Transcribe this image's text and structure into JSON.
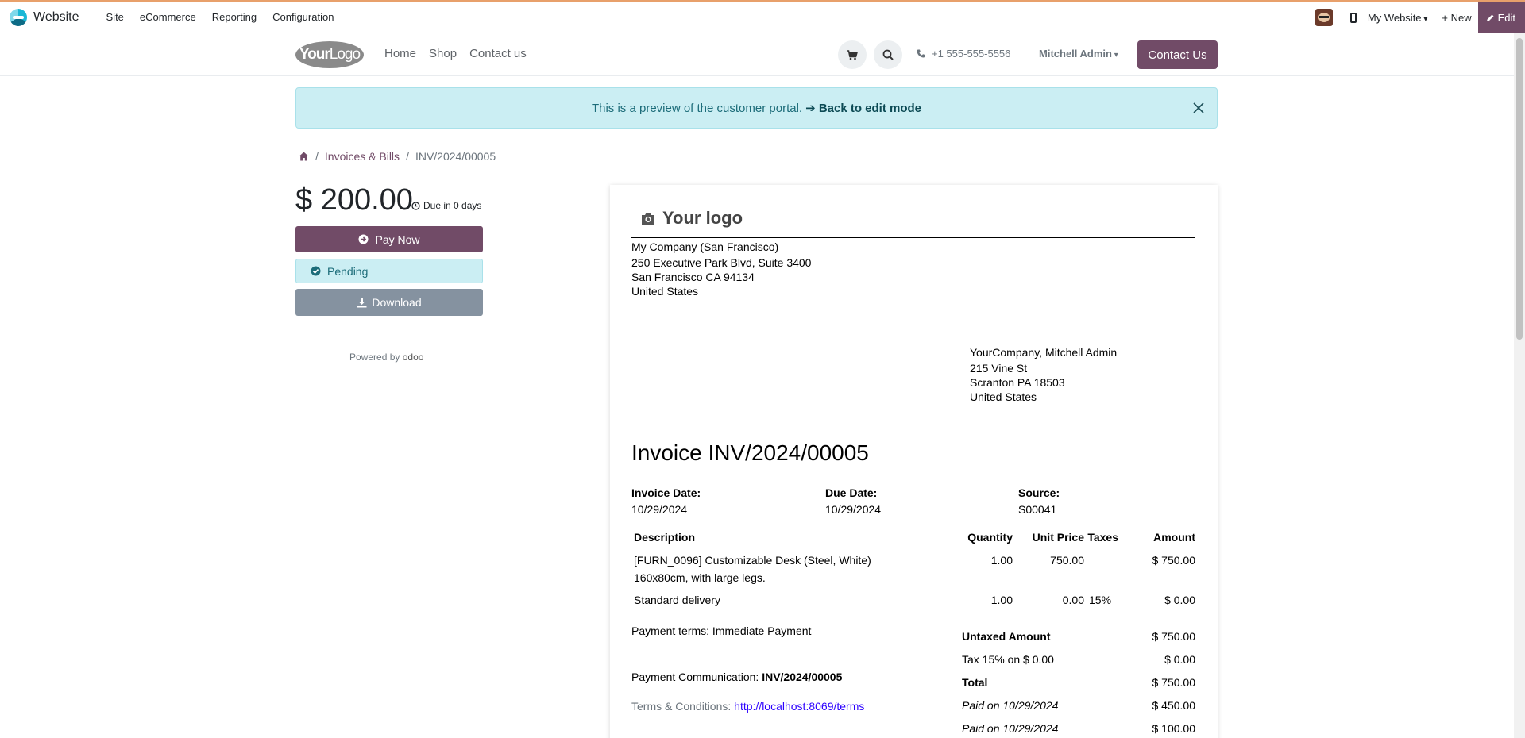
{
  "admin_bar": {
    "app_name": "Website",
    "menu": [
      "Site",
      "eCommerce",
      "Reporting",
      "Configuration"
    ],
    "website_select": "My Website",
    "new_label": "New",
    "edit_label": "Edit"
  },
  "site_header": {
    "logo_text_bold": "Your",
    "logo_text_light": "Logo",
    "nav": [
      "Home",
      "Shop",
      "Contact us"
    ],
    "phone": "+1 555-555-5556",
    "user": "Mitchell Admin",
    "contact_button": "Contact Us"
  },
  "preview_alert": {
    "text": "This is a preview of the customer portal.",
    "link": "Back to edit mode"
  },
  "breadcrumb": {
    "parent": "Invoices & Bills",
    "current": "INV/2024/00005"
  },
  "summary": {
    "amount": "$ 200.00",
    "due": "Due in 0 days",
    "pay_now": "Pay Now",
    "status": "Pending",
    "download": "Download",
    "powered_by": "Powered by",
    "powered_brand": "odoo"
  },
  "invoice": {
    "logo_text": "Your logo",
    "company": {
      "name": "My Company (San Francisco)",
      "street": "250 Executive Park Blvd, Suite 3400",
      "city": "San Francisco CA 94134",
      "country": "United States"
    },
    "partner": {
      "name": "YourCompany, Mitchell Admin",
      "street": "215 Vine St",
      "city": "Scranton PA 18503",
      "country": "United States"
    },
    "title": "Invoice INV/2024/00005",
    "invoice_date_label": "Invoice Date:",
    "invoice_date": "10/29/2024",
    "due_date_label": "Due Date:",
    "due_date": "10/29/2024",
    "source_label": "Source:",
    "source": "S00041",
    "columns": {
      "description": "Description",
      "quantity": "Quantity",
      "unit_price": "Unit Price",
      "taxes": "Taxes",
      "amount": "Amount"
    },
    "lines": [
      {
        "desc1": "[FURN_0096] Customizable Desk (Steel, White)",
        "desc2": "160x80cm, with large legs.",
        "qty": "1.00",
        "price": "750.00",
        "tax": "",
        "amount": "$ 750.00"
      },
      {
        "desc1": "Standard delivery",
        "desc2": "",
        "qty": "1.00",
        "price": "0.00",
        "tax": "15%",
        "amount": "$ 0.00"
      }
    ],
    "payment_terms": "Payment terms: Immediate Payment",
    "payment_comm_label": "Payment Communication:",
    "payment_comm_value": "INV/2024/00005",
    "terms_label": "Terms & Conditions:",
    "terms_link": "http://localhost:8069/terms",
    "totals": {
      "untaxed_label": "Untaxed Amount",
      "untaxed": "$ 750.00",
      "tax_label": "Tax 15% on $ 0.00",
      "tax": "$ 0.00",
      "total_label": "Total",
      "total": "$ 750.00",
      "paid1_label": "Paid on 10/29/2024",
      "paid1": "$ 450.00",
      "paid2_label": "Paid on 10/29/2024",
      "paid2": "$ 100.00"
    }
  }
}
